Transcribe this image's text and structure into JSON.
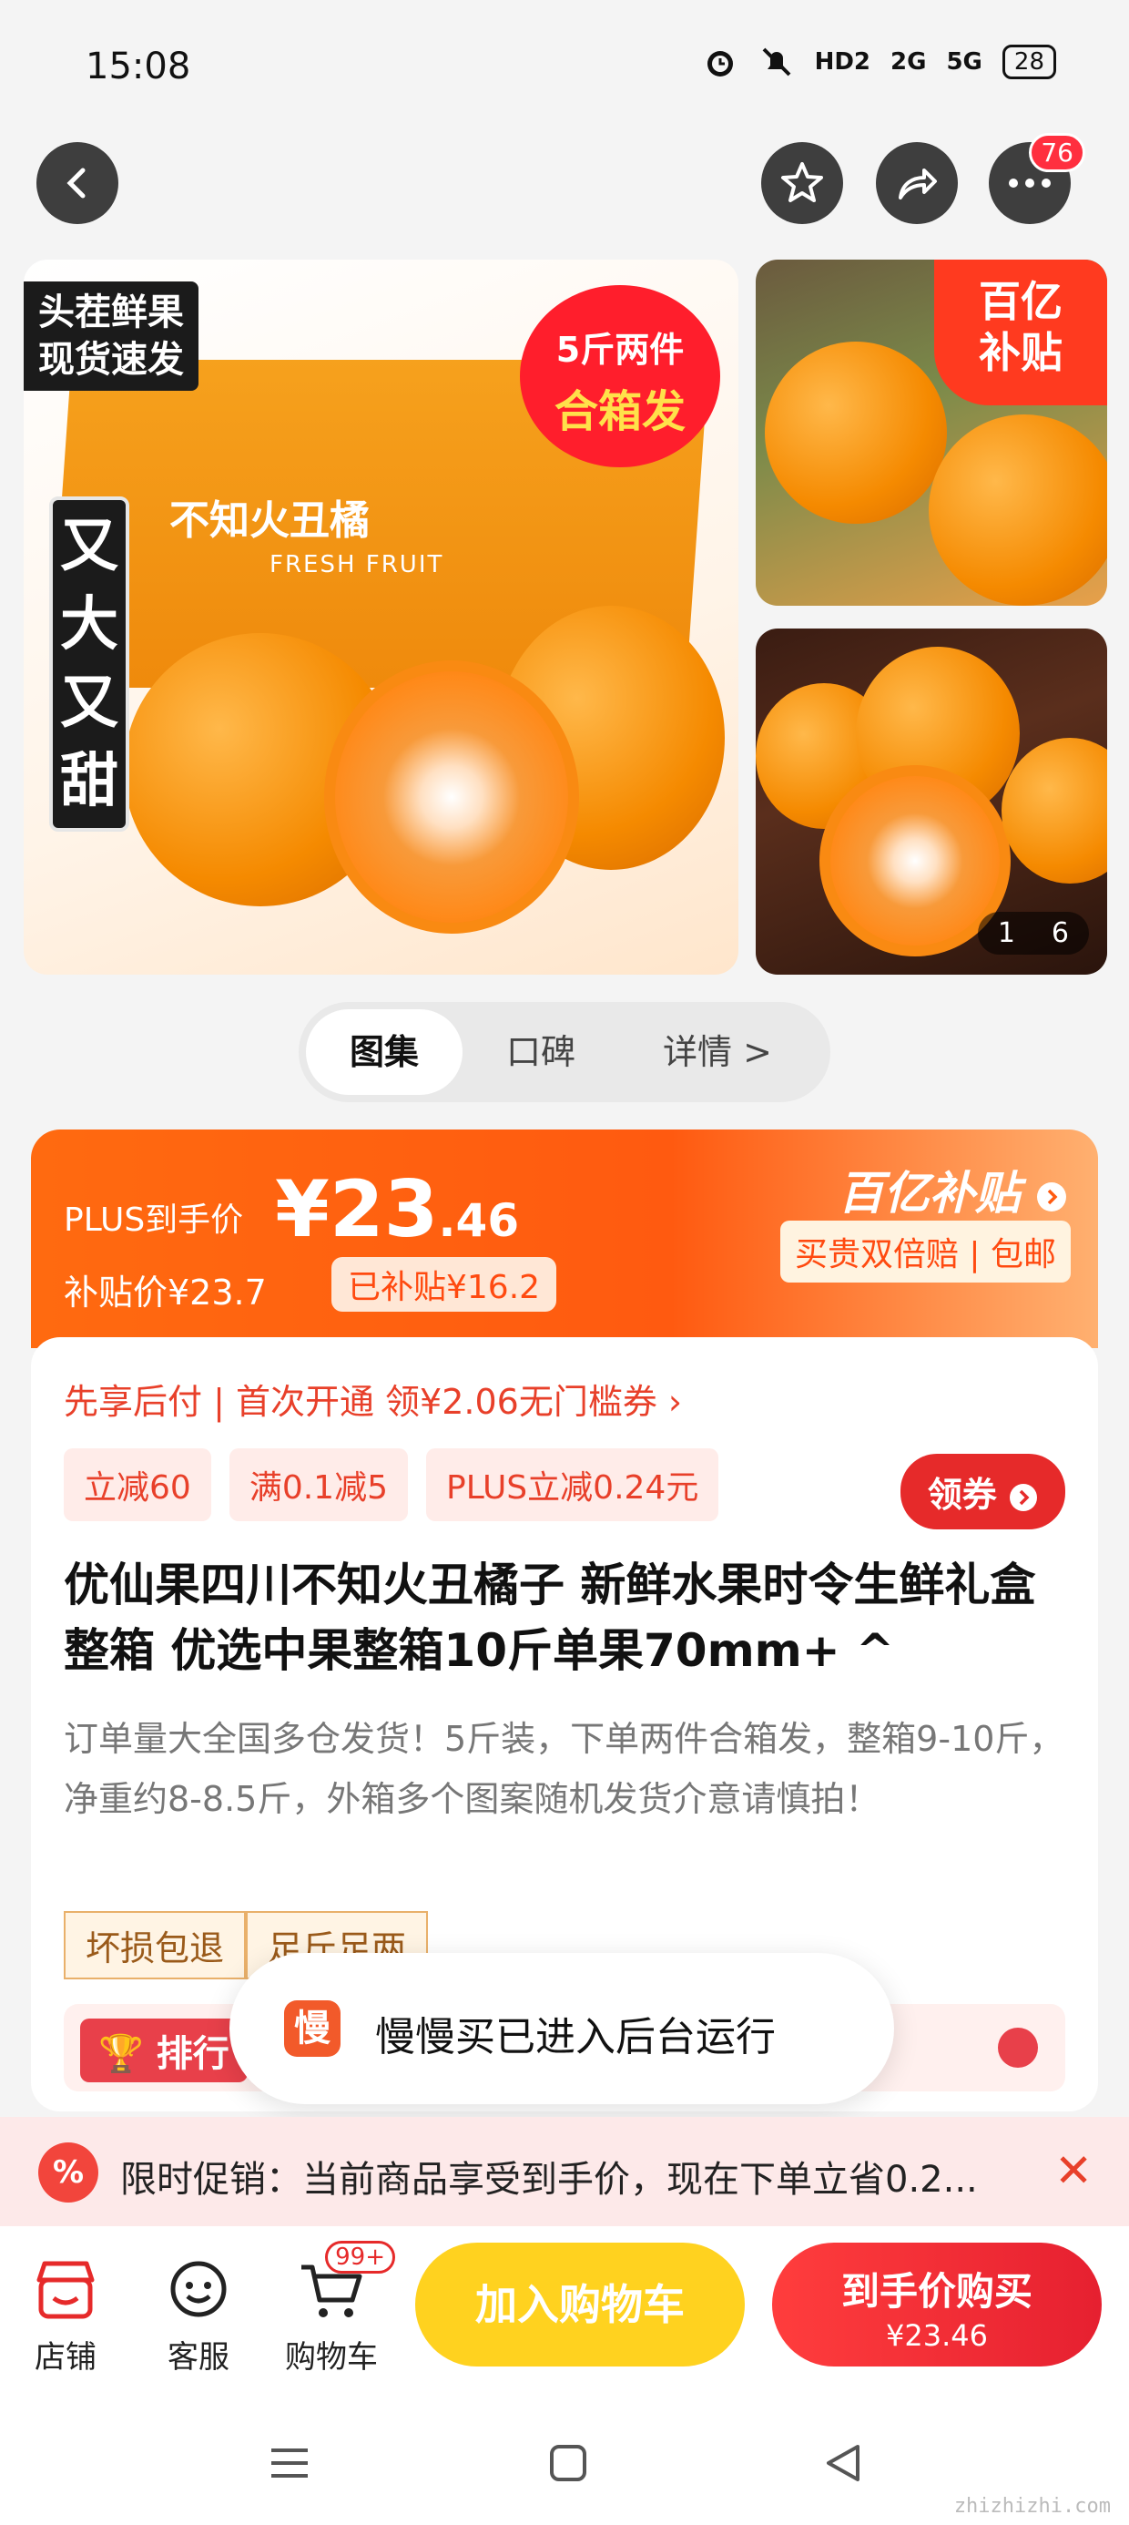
{
  "status_bar": {
    "time": "15:08",
    "network_1": "HD2",
    "network_2": "2G",
    "network_3": "5G",
    "battery": "28"
  },
  "nav": {
    "badge_count": "76"
  },
  "gallery": {
    "main_tag_top": "头茬鲜果\n现货速发",
    "main_tag_round_1": "5斤两件",
    "main_tag_round_2": "合箱发",
    "main_tag_vertical": "又大又甜",
    "box_title": "不知火丑橘",
    "box_sub": "FRESH FRUIT",
    "subsidy_corner": "百亿\n补贴",
    "counter_current": "1",
    "counter_total": "6"
  },
  "tabs": [
    {
      "label": "图集",
      "active": true
    },
    {
      "label": "口碑",
      "active": false
    },
    {
      "label": "详情 >",
      "active": false
    }
  ],
  "price": {
    "plus_label": "PLUS到手价",
    "currency": "¥",
    "integer": "23",
    "decimal": ".46",
    "subsidy_price": "补贴价¥23.7",
    "subsidy_badge": "已补贴¥16.2",
    "billion_logo": "百亿补贴",
    "billion_sub": "买贵双倍赔 | 包邮"
  },
  "info": {
    "first_pay": "先享后付 | 首次开通 领¥2.06无门槛券 ›",
    "chips": [
      "立减60",
      "满0.1减5",
      "PLUS立减0.24元"
    ],
    "coupon_btn": "领券",
    "title": "优仙果四川不知火丑橘子 新鲜水果时令生鲜礼盒整箱 优选中果整箱10斤单果70mm+ ^",
    "desc": "订单量大全国多仓发货！5斤装，下单两件合箱发，整箱9-10斤，净重约8-8.5斤，外箱多个图案随机发货介意请慎拍！",
    "tags": [
      "坏损包退",
      "足斤足两"
    ],
    "rank_label": "排行"
  },
  "toast": {
    "logo_char": "慢",
    "text": "慢慢买已进入后台运行"
  },
  "promo": {
    "icon": "%",
    "text": "限时促销：当前商品享受到手价，现在下单立省0.2...",
    "close": "✕"
  },
  "bottom_bar": {
    "store": "店铺",
    "service": "客服",
    "cart": "购物车",
    "cart_badge": "99+",
    "add_to_cart": "加入购物车",
    "buy_label": "到手价购买",
    "buy_price": "¥23.46"
  },
  "watermark": "zhizhizhi.com",
  "colors": {
    "accent": "#ff5a10",
    "buy_red": "#e62030",
    "cart_yellow": "#ffd21f"
  }
}
